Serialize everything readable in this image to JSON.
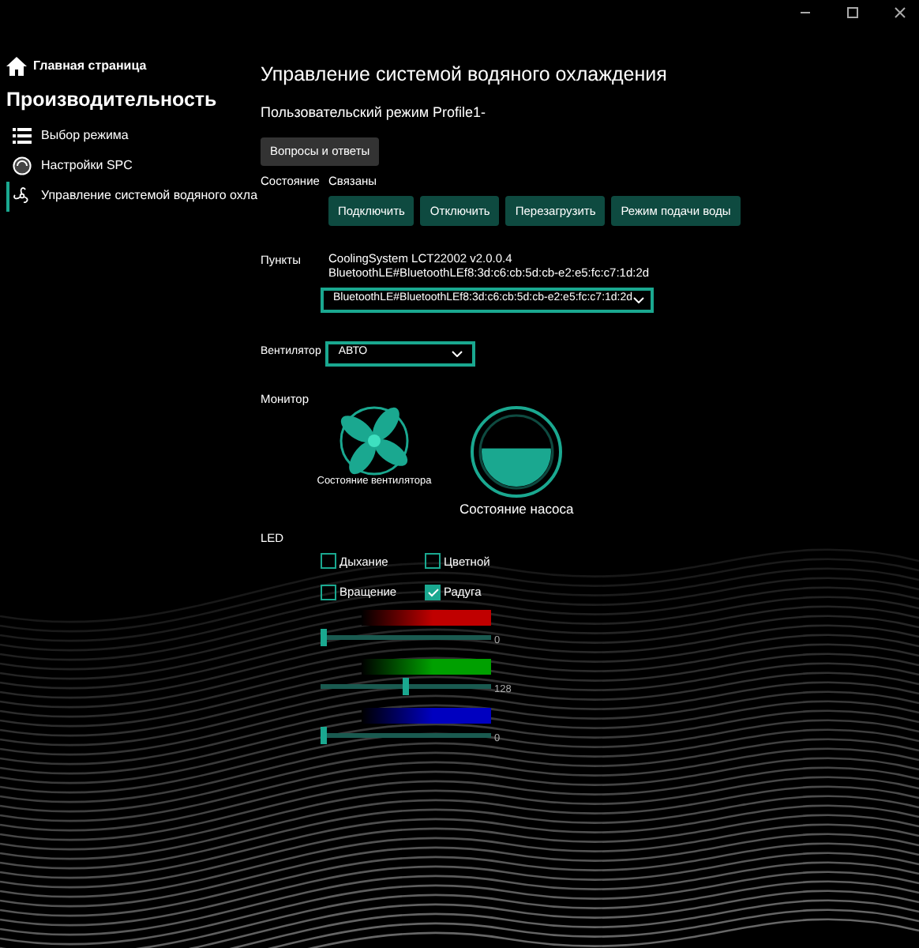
{
  "sidebar": {
    "home": "Главная страница",
    "section": "Производительность",
    "items": [
      {
        "label": "Выбор режима",
        "selected": false
      },
      {
        "label": "Настройки SPC",
        "selected": false
      },
      {
        "label": "Управление системой водяного охла",
        "selected": true
      }
    ]
  },
  "title": "Управление системой водяного охлаждения",
  "profile": "Пользовательский режим Profile1-",
  "faq_button": "Вопросы и ответы",
  "status": {
    "label": "Состояние",
    "value": "Связаны"
  },
  "actions": [
    "Подключить",
    "Отключить",
    "Перезагрузить",
    "Режим подачи воды"
  ],
  "points": {
    "label": "Пункты",
    "device": "CoolingSystem LCT22002 v2.0.0.4",
    "address": "BluetoothLE#BluetoothLEf8:3d:c6:cb:5d:cb-e2:e5:fc:c7:1d:2d",
    "selected": "BluetoothLE#BluetoothLEf8:3d:c6:cb:5d:cb-e2:e5:fc:c7:1d:2d"
  },
  "fan": {
    "label": "Вентилятор",
    "value": "АВТО"
  },
  "monitor": {
    "label": "Монитор",
    "fan_caption": "Состояние вентилятора",
    "pump_caption": "Состояние насоса"
  },
  "led": {
    "label": "LED",
    "options": [
      {
        "label": "Дыхание",
        "checked": false
      },
      {
        "label": "Цветной",
        "checked": false
      },
      {
        "label": "Вращение",
        "checked": false
      },
      {
        "label": "Радуга",
        "checked": true
      }
    ],
    "channels": [
      {
        "color": "#c00000",
        "level": 0,
        "reading": "0"
      },
      {
        "color": "#00a000",
        "level": 0.5,
        "reading": "128"
      },
      {
        "color": "#0000c0",
        "level": 0,
        "reading": "0"
      }
    ]
  }
}
